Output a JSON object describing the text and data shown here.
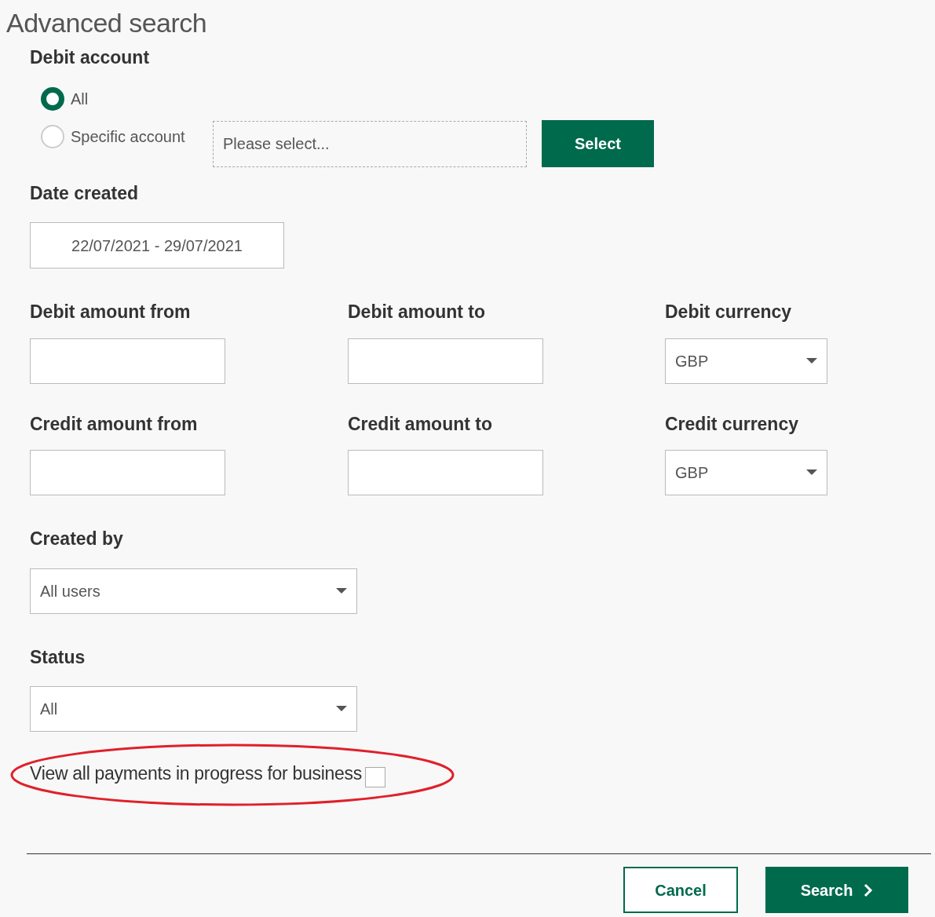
{
  "title": "Advanced search",
  "debit_account": {
    "label": "Debit account",
    "options": [
      {
        "label": "All",
        "selected": true
      },
      {
        "label": "Specific account",
        "selected": false
      }
    ],
    "account_field": {
      "placeholder": "Please select..."
    },
    "select_button": "Select"
  },
  "date_created": {
    "label": "Date created",
    "value": "22/07/2021 - 29/07/2021"
  },
  "amount_rows": [
    {
      "fields": [
        {
          "kind": "input",
          "label": "Debit amount from"
        },
        {
          "kind": "input",
          "label": "Debit amount to"
        },
        {
          "kind": "dropdown",
          "label": "Debit currency",
          "value": "GBP"
        }
      ]
    },
    {
      "fields": [
        {
          "kind": "input",
          "label": "Credit amount from"
        },
        {
          "kind": "input",
          "label": "Credit amount to"
        },
        {
          "kind": "dropdown",
          "label": "Credit currency",
          "value": "GBP"
        }
      ]
    }
  ],
  "created_by": {
    "label": "Created by",
    "value": "All users"
  },
  "status": {
    "label": "Status",
    "value": "All"
  },
  "in_progress": {
    "label": "View all payments in progress for business",
    "checked": false
  },
  "buttons": {
    "cancel": "Cancel",
    "search": "Search"
  }
}
